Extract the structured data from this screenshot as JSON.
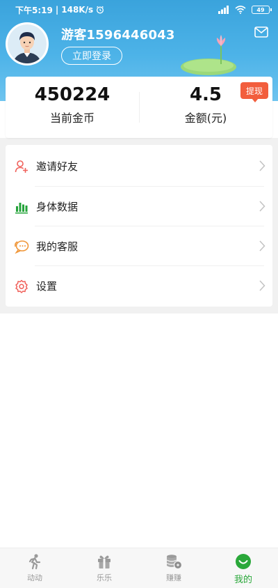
{
  "status_bar": {
    "time": "下午5:19",
    "speed": "148K/s",
    "battery": "49"
  },
  "profile": {
    "username": "游客1596446043",
    "login_label": "立即登录"
  },
  "balance": {
    "coins_value": "450224",
    "coins_label": "当前金币",
    "amount_value": "4.5",
    "amount_label": "金额(元)",
    "withdraw_label": "提现"
  },
  "menu": {
    "items": [
      {
        "label": "邀请好友",
        "icon": "invite-friend-icon"
      },
      {
        "label": "身体数据",
        "icon": "body-data-icon"
      },
      {
        "label": "我的客服",
        "icon": "customer-service-icon"
      },
      {
        "label": "设置",
        "icon": "settings-gear-icon"
      }
    ]
  },
  "bottom_nav": {
    "items": [
      {
        "label": "动动",
        "icon": "running-person-icon",
        "active": false
      },
      {
        "label": "乐乐",
        "icon": "gift-box-icon",
        "active": false
      },
      {
        "label": "赚赚",
        "icon": "coin-stack-icon",
        "active": false
      },
      {
        "label": "我的",
        "icon": "smiley-face-icon",
        "active": true
      }
    ]
  },
  "colors": {
    "header_blue": "#3aa3dc",
    "withdraw_red": "#f25e3d",
    "active_green": "#2aa83a",
    "bar_green": "#24a33a",
    "icon_orange": "#f0973a"
  }
}
